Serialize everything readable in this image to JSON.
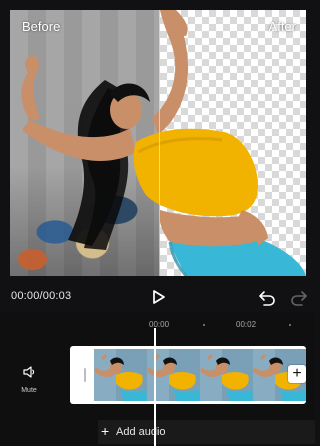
{
  "preview": {
    "before_label": "Before",
    "after_label": "After"
  },
  "controls": {
    "time_display": "00:00/00:03",
    "play_icon": "play-icon",
    "undo_icon": "undo-icon",
    "redo_icon": "redo-icon"
  },
  "timeline": {
    "ruler": [
      "00:00",
      "00:02"
    ],
    "mute_label": "Mute",
    "add_audio_label": "Add audio",
    "frame_count": 4
  },
  "colors": {
    "background": "#111113",
    "accent_yellow": "#f4b400",
    "jeans_blue": "#38b7d6",
    "track_white": "#ffffff"
  }
}
